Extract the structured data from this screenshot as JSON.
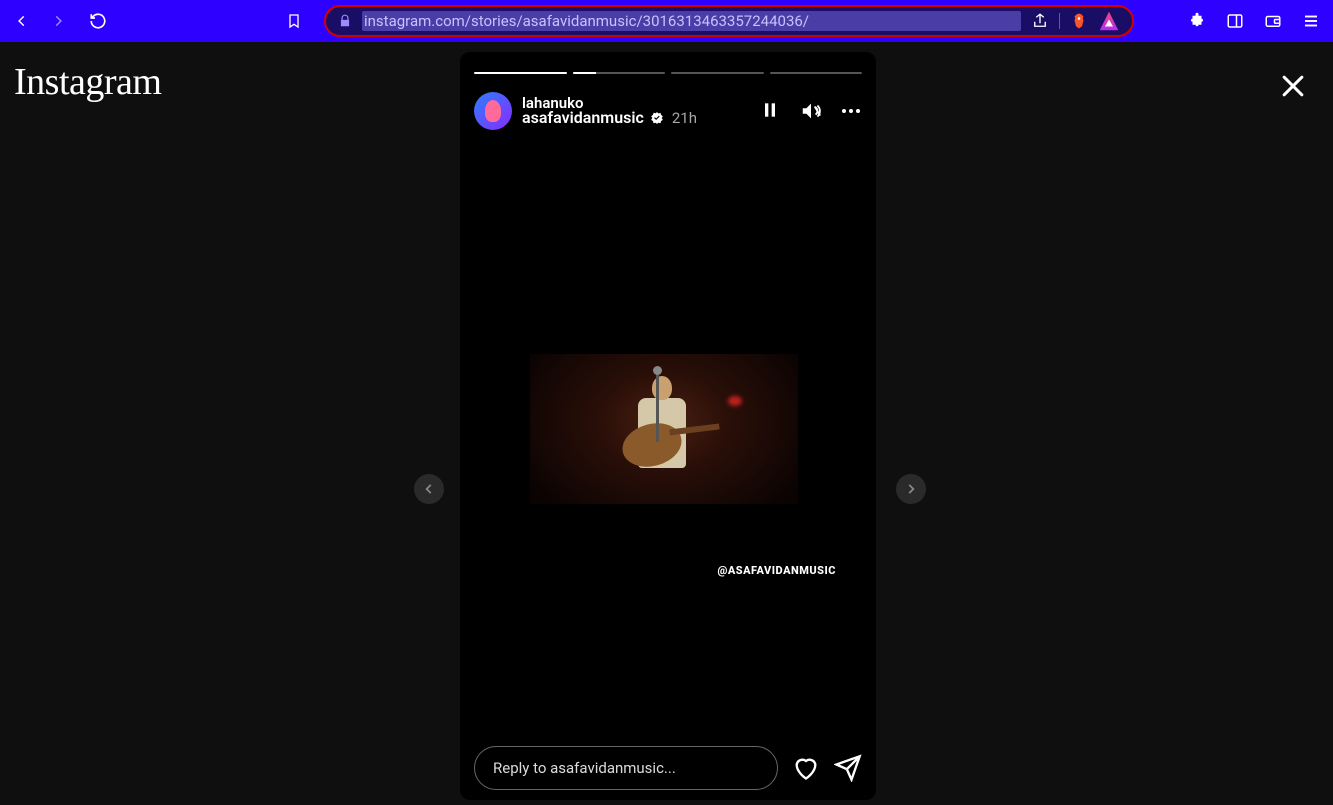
{
  "browser": {
    "url": "instagram.com/stories/asafavidanmusic/3016313463357244036/"
  },
  "page": {
    "logo": "Instagram"
  },
  "story": {
    "segments": 4,
    "reposter": "lahanuko",
    "username": "asafavidanmusic",
    "timestamp": "21h",
    "handle_tag": "@ASAFAVIDANMUSIC",
    "reply_placeholder": "Reply to asafavidanmusic..."
  }
}
